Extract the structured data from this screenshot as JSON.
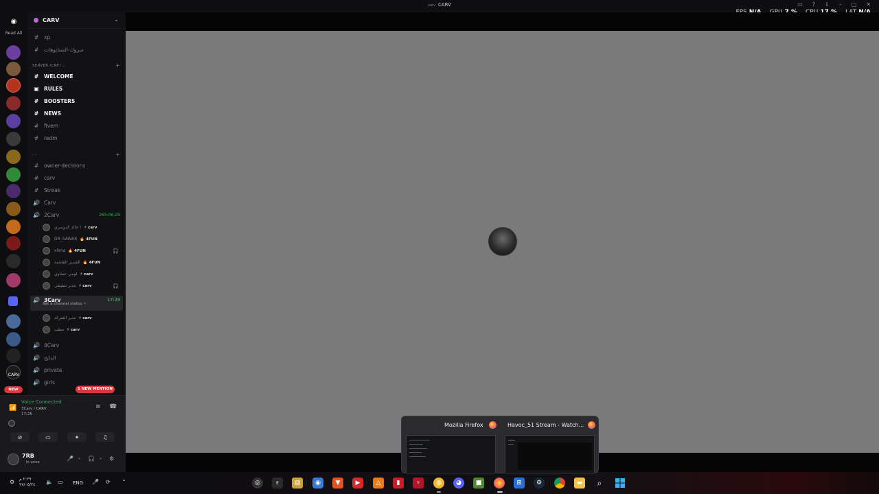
{
  "window": {
    "title": "CARV",
    "title_prefix": "carv"
  },
  "perf": {
    "fps_label": "FPS",
    "fps_value": "N/A",
    "gpu_label": "GPU",
    "gpu_value": "7 %",
    "cpu_label": "CPU",
    "cpu_value": "17 %",
    "lat_label": "LAT",
    "lat_value": "N/A"
  },
  "guilds": {
    "read_all": "Read All",
    "new_badge": "NEW",
    "carv_label": "CARV"
  },
  "server": {
    "name": "CARV"
  },
  "channels": {
    "top": [
      {
        "icon": "#",
        "label": "xp"
      },
      {
        "icon": "#",
        "label": "مبروك-السنابوهات"
      }
    ],
    "category1": "SERVER ICNFI ⌄",
    "cat1_items": [
      {
        "icon": "#",
        "label": "WELCOME",
        "bold": true
      },
      {
        "icon": "▣",
        "label": "RULES",
        "bold": true
      },
      {
        "icon": "#",
        "label": "BOOSTERS",
        "bold": true
      },
      {
        "icon": "#",
        "label": "NEWS",
        "bold": true
      },
      {
        "icon": "#",
        "label": "fivem",
        "bold": false
      },
      {
        "icon": "#",
        "label": "redm",
        "bold": false
      }
    ],
    "category2": "- -",
    "cat2_items": [
      {
        "icon": "#",
        "label": "owner-decisions"
      },
      {
        "icon": "#",
        "label": "carv"
      },
      {
        "icon": "#",
        "label": "Streak"
      },
      {
        "icon": "🔊",
        "label": "Carv"
      }
    ],
    "voice_2carv": {
      "label": "2Carv",
      "timer": "265:06:29"
    },
    "voice_2carv_users": [
      {
        "name": "خالد الدوسري !",
        "tag": "⚡ carv"
      },
      {
        "name": "DR_SAWAR",
        "tag": "🔥 4FUN"
      },
      {
        "name": "xlima",
        "tag": "🔥 4FUN"
      },
      {
        "name": "القصير القلحمة",
        "tag": "🔥 4FUN"
      },
      {
        "name": "لومي عساوي",
        "tag": "⚡ carv"
      },
      {
        "name": "مدير تطبيقي",
        "tag": "⚡ carv"
      }
    ],
    "voice_3carv": {
      "label": "3Carv",
      "timer": "17:29",
      "status": "Set a channel status ✎"
    },
    "voice_3carv_users": [
      {
        "name": "مدير الشركة",
        "tag": "⚡ carv"
      },
      {
        "name": "مطب",
        "tag": "⚡ carv"
      }
    ],
    "bottom": [
      {
        "icon": "🔊",
        "label": "4Carv"
      },
      {
        "icon": "🔊",
        "label": "الدايح"
      },
      {
        "icon": "🔊",
        "label": "private"
      },
      {
        "icon": "🔊",
        "label": "girls"
      }
    ],
    "mention": "1 NEW MENTION"
  },
  "voice_panel": {
    "status": "Voice Connected",
    "channel": "3Carv / CARV",
    "time": "17:25",
    "user": "7RB",
    "user_status": "In voice"
  },
  "taskbar": {
    "lang": "ENG",
    "clock_time": "٢:٢٩ م",
    "clock_date": "٢٧/٠٥/٢٤",
    "apps": [
      "obs-icon",
      "epic-icon",
      "files-icon",
      "app-icon",
      "brave-icon",
      "youtube-icon",
      "vlc-icon",
      "winrar-icon",
      "voice-icon",
      "chat-icon",
      "discord-icon",
      "minecraft-icon",
      "firefox-icon",
      "store-icon",
      "steam-icon",
      "chrome-icon",
      "explorer-icon",
      "search-icon",
      "windows-icon"
    ]
  },
  "preview": {
    "left_title": "Mozilla Firefox",
    "right_title": "Havoc_51 Stream - Watch..."
  }
}
